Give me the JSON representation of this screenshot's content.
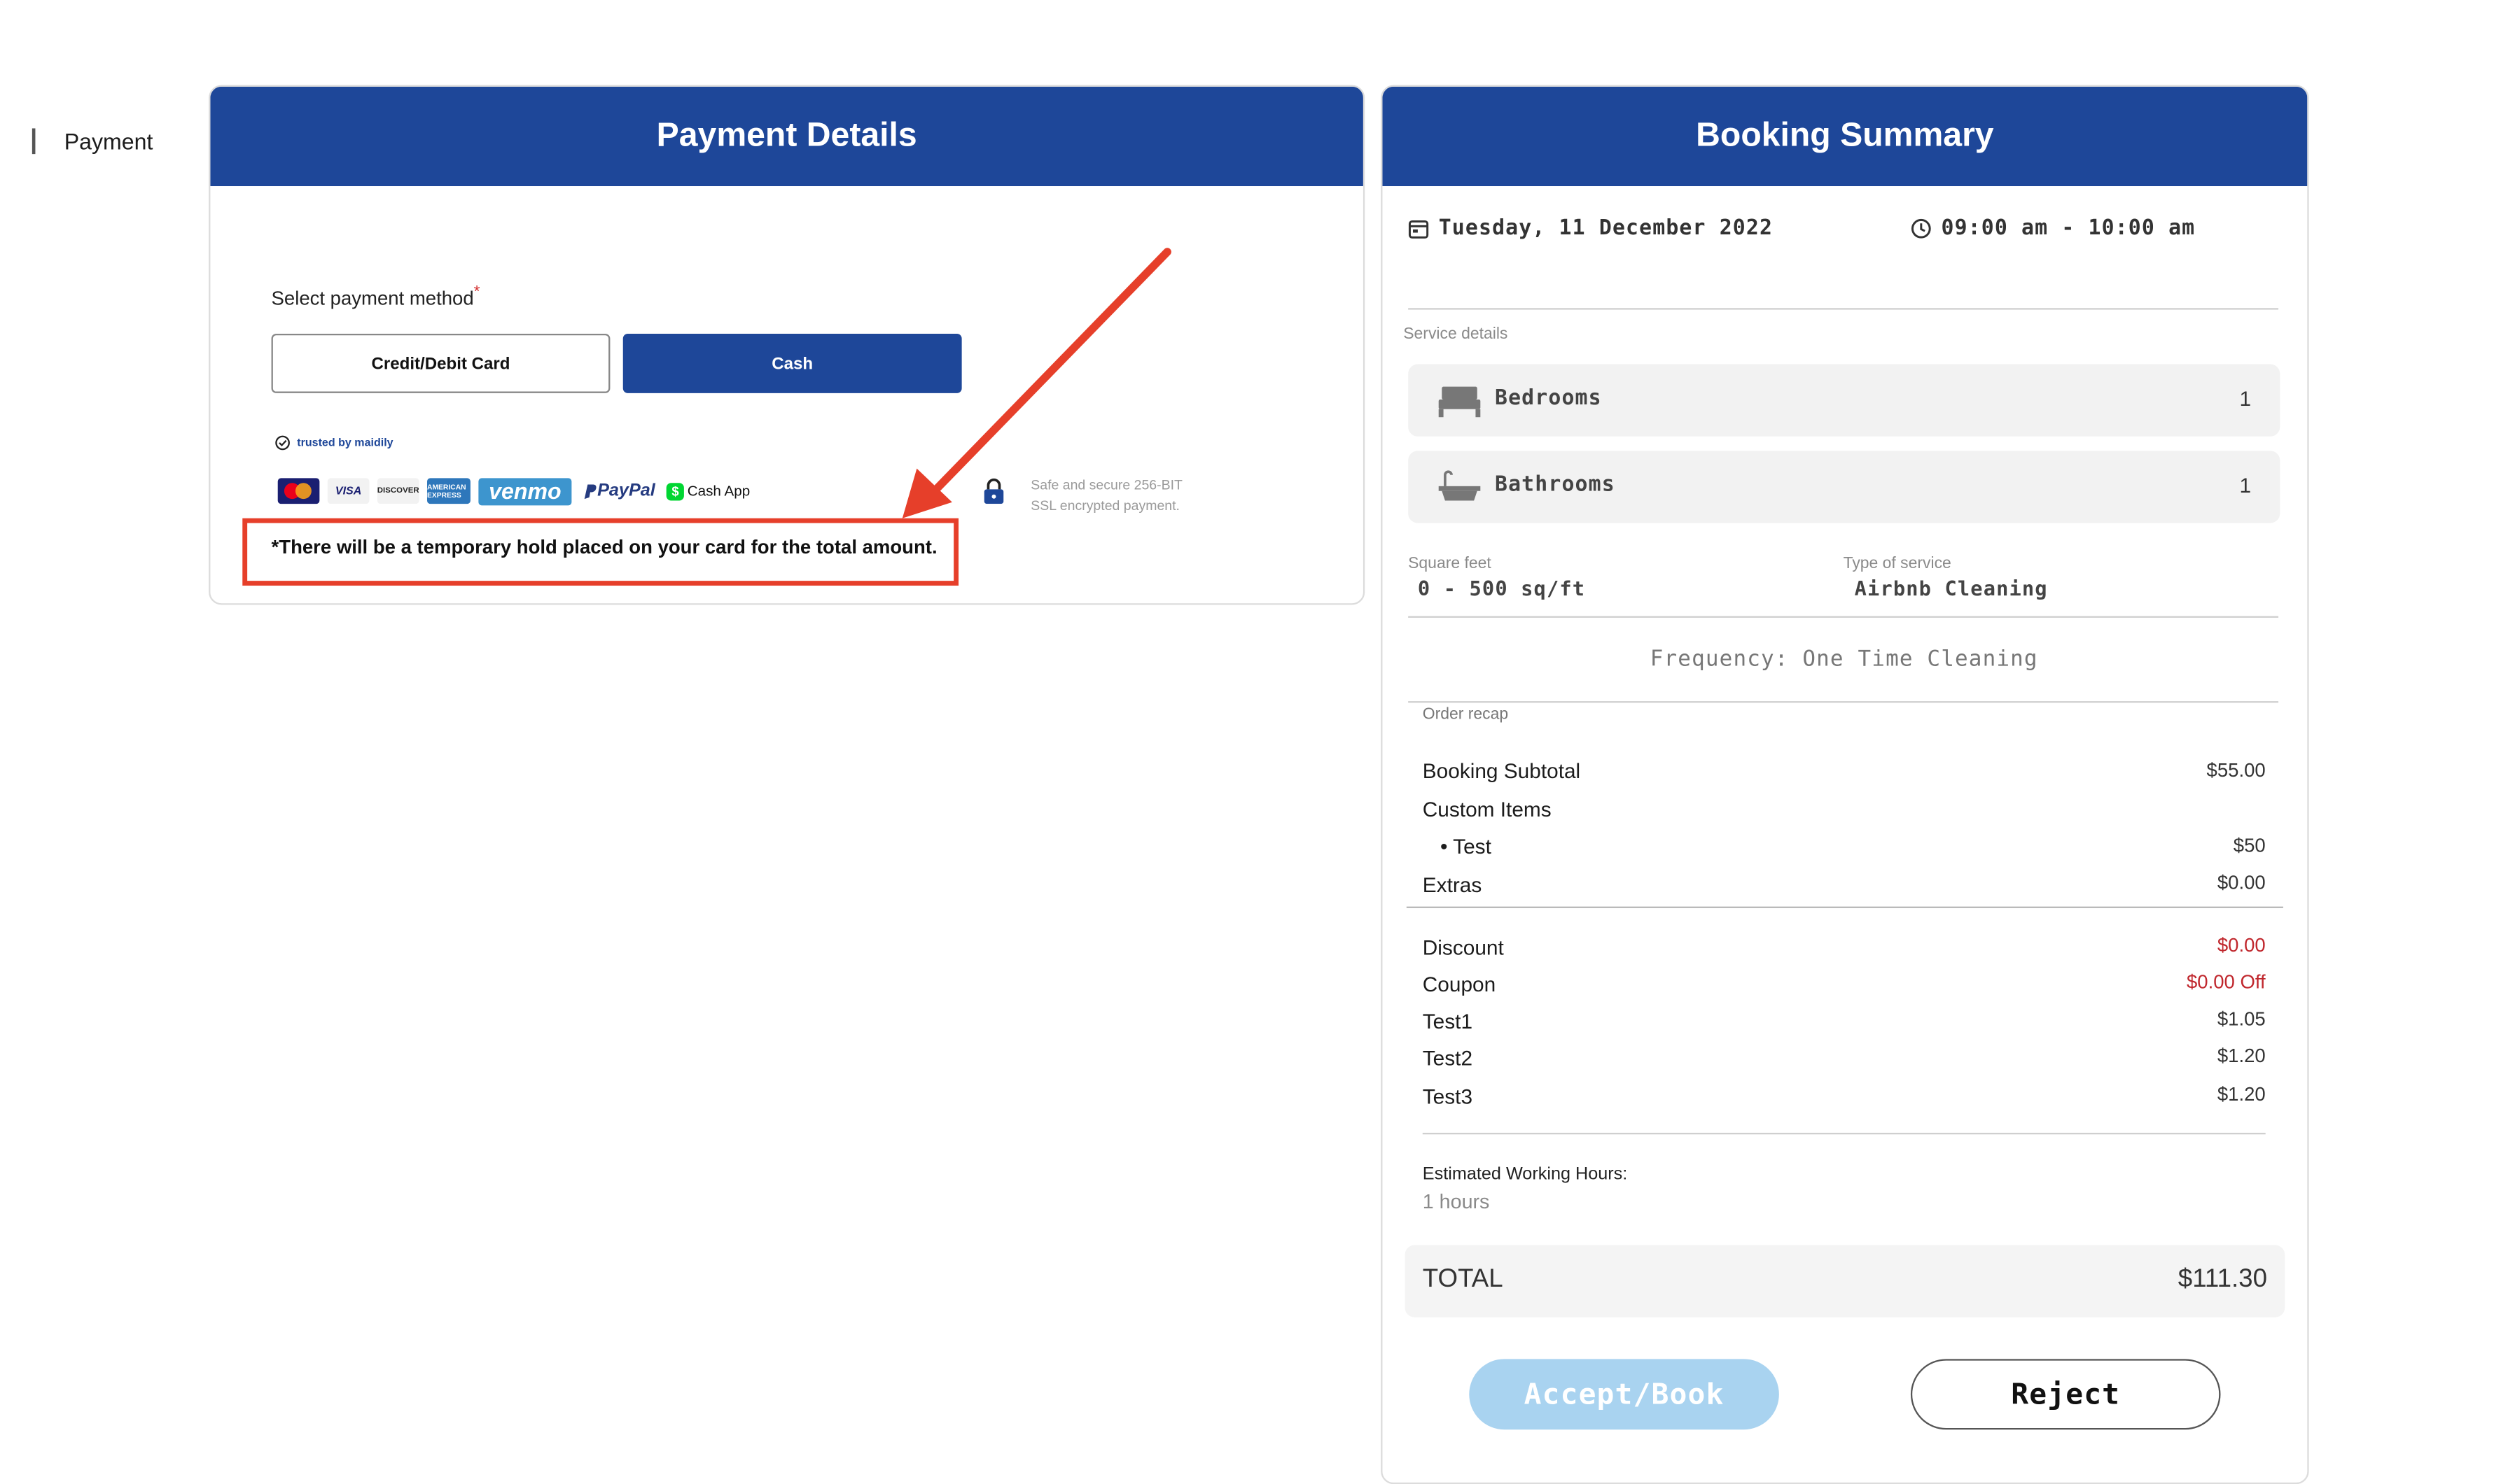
{
  "payment": {
    "header": "Payment Details",
    "section_label": "Payment",
    "method_label": "Select payment method",
    "required_mark": "*",
    "options": [
      "Credit/Debit Card",
      "Cash"
    ],
    "selected": "Cash",
    "trusted_label": "trusted by maidily",
    "logos": {
      "visa": "VISA",
      "discover": "DISCOVER",
      "amex": "AMERICAN EXPRESS",
      "venmo": "venmo",
      "paypal": "PayPal",
      "cashapp": "Cash App"
    },
    "secure_line1": "Safe and secure 256-BIT",
    "secure_line2": "SSL encrypted payment.",
    "hold_notice": "*There will be a temporary hold placed on your card for the total amount.",
    "annotation_color": "#e63f2a"
  },
  "booking": {
    "header": "Booking Summary",
    "date": "Tuesday, 11 December 2022",
    "time": "09:00 am - 10:00 am",
    "service_details_label": "Service details",
    "services": [
      {
        "name": "Bedrooms",
        "value": "1",
        "icon": "bed-icon"
      },
      {
        "name": "Bathrooms",
        "value": "1",
        "icon": "bathtub-icon"
      }
    ],
    "square_feet_label": "Square feet",
    "square_feet_value": "0 - 500 sq/ft",
    "service_type_label": "Type of service",
    "service_type_value": "Airbnb Cleaning",
    "frequency": "Frequency: One Time Cleaning",
    "order_recap_label": "Order recap",
    "recap": {
      "subtotal_label": "Booking Subtotal",
      "subtotal_value": "$55.00",
      "custom_label": "Custom Items",
      "custom_item_label": "• Test",
      "custom_item_value": "$50",
      "extras_label": "Extras",
      "extras_value": "$0.00",
      "discount_label": "Discount",
      "discount_value": "$0.00",
      "coupon_label": "Coupon",
      "coupon_value": "$0.00 Off",
      "test1_label": "Test1",
      "test1_value": "$1.05",
      "test2_label": "Test2",
      "test2_value": "$1.20",
      "test3_label": "Test3",
      "test3_value": "$1.20"
    },
    "hours_label": "Estimated Working Hours:",
    "hours_value": "1 hours",
    "total_label": "TOTAL",
    "total_value": "$111.30",
    "accept_label": "Accept/Book",
    "reject_label": "Reject"
  },
  "colors": {
    "brand": "#1e4799",
    "accent_light": "#a9d3f0",
    "negative": "#c0272d"
  }
}
